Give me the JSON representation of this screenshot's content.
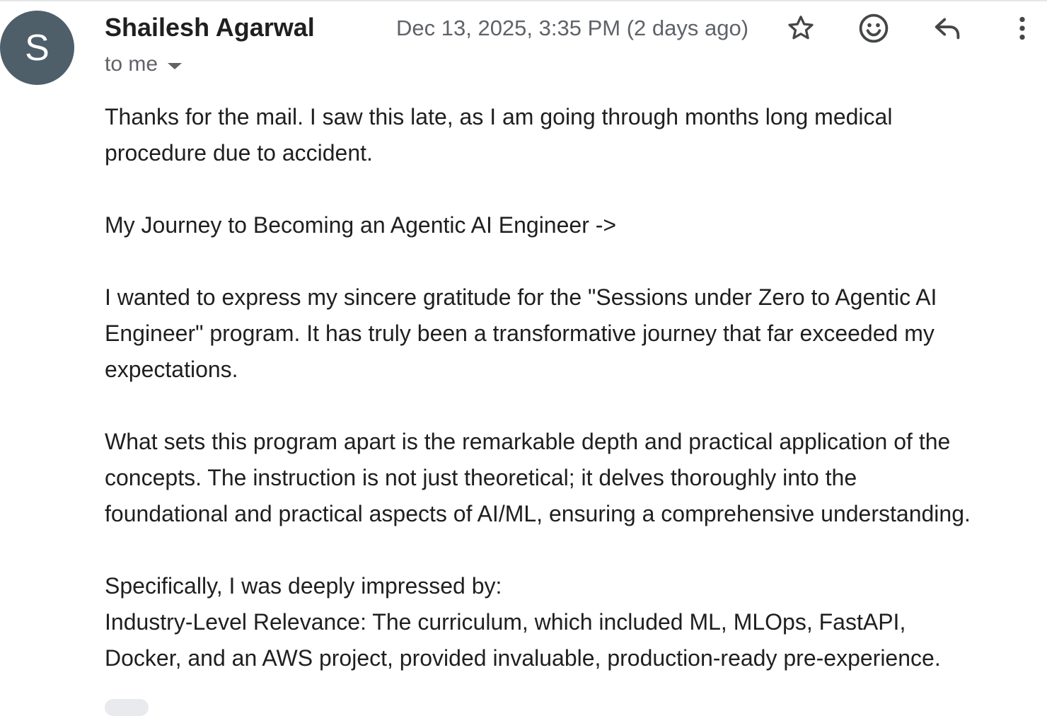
{
  "sender": {
    "avatar_letter": "S",
    "name": "Shailesh Agarwal",
    "recipient": "to me",
    "date": "Dec 13, 2025, 3:35 PM (2 days ago)"
  },
  "actions": {
    "star": "star-icon",
    "emoji": "emoji-icon",
    "reply": "reply-icon",
    "more": "more-vert-icon"
  },
  "body": {
    "p1": "Thanks for the mail. I saw this late, as I am going through months long medical\nprocedure due to accident.",
    "p2": "My Journey to Becoming an Agentic AI Engineer ->",
    "p3": "I wanted to express my sincere gratitude for the \"Sessions under Zero to Agentic AI\nEngineer\" program. It has truly been a transformative journey that far exceeded my\nexpectations.",
    "p4": "What sets this program apart is the remarkable depth and practical application of the\nconcepts. The instruction is not just theoretical; it delves thoroughly into the\nfoundational and practical aspects of AI/ML, ensuring a comprehensive understanding.",
    "p5a": "Specifically, I was deeply impressed by:",
    "p5b": "Industry-Level Relevance: The curriculum, which included ML, MLOps, FastAPI,\nDocker, and an AWS project, provided invaluable, production-ready pre-experience."
  },
  "colors": {
    "avatar_bg": "#4e5f6a",
    "meta_text": "#5f6368",
    "body_text": "#1f1f1f"
  }
}
